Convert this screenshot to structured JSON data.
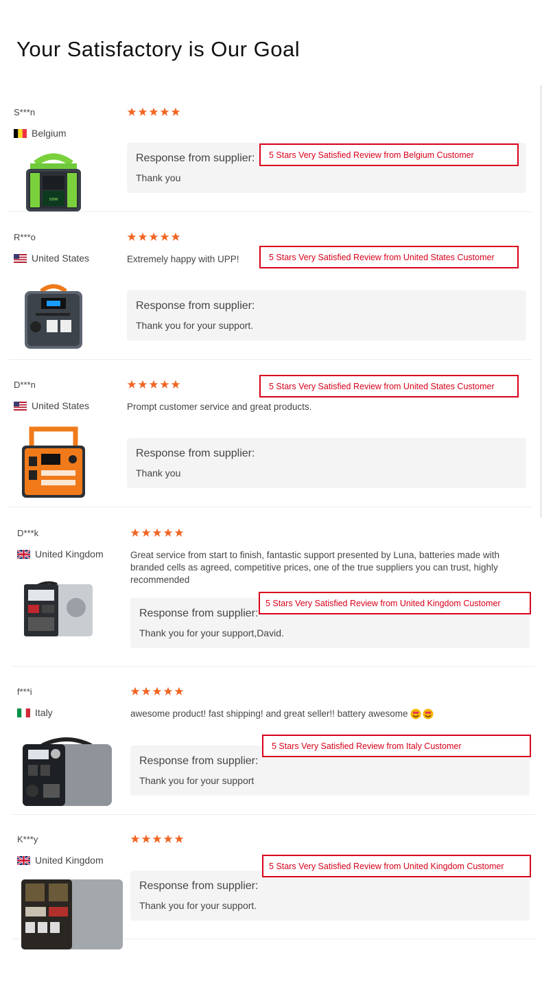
{
  "page": {
    "title": "Your Satisfactory is Our Goal"
  },
  "colors": {
    "star": "#f26522",
    "callout_border": "#d8001a",
    "response_bg": "#f4f4f4"
  },
  "reviews": [
    {
      "reviewer": "S***n",
      "country": "Belgium",
      "flag": "be-flag-icon",
      "rating": 5,
      "comment": "",
      "response_title": "Response from supplier:",
      "response_text": "Thank you",
      "callout": "5 Stars Very Satisfied Review from Belgium Customer"
    },
    {
      "reviewer": "R***o",
      "country": "United States",
      "flag": "us-flag-icon",
      "rating": 5,
      "comment": "Extremely happy with UPP!",
      "response_title": "Response from supplier:",
      "response_text": "Thank you for your support.",
      "callout": "5 Stars Very Satisfied Review from United States Customer"
    },
    {
      "reviewer": "D***n",
      "country": "United States",
      "flag": "us-flag-icon",
      "rating": 5,
      "comment": "Prompt customer service and great products.",
      "response_title": "Response from supplier:",
      "response_text": "Thank you",
      "callout": "5 Stars Very Satisfied Review from United States Customer"
    },
    {
      "reviewer": "D***k",
      "country": "United Kingdom",
      "flag": "uk-flag-icon",
      "rating": 5,
      "comment": "Great service from start to finish, fantastic support presented by Luna, batteries made with branded cells as agreed, competitive prices, one of the true suppliers you can trust, highly recommended",
      "response_title": "Response from supplier:",
      "response_text": "Thank you for your support,David.",
      "callout": "5 Stars Very Satisfied Review from United Kingdom Customer"
    },
    {
      "reviewer": "f***i",
      "country": "Italy",
      "flag": "it-flag-icon",
      "rating": 5,
      "comment": "awesome product! fast shipping! and great seller!! battery awesome",
      "response_title": "Response from supplier:",
      "response_text": "Thank you for your support",
      "callout": "5 Stars Very Satisfied Review from Italy Customer"
    },
    {
      "reviewer": "K***y",
      "country": "United Kingdom",
      "flag": "uk-flag-icon",
      "rating": 5,
      "comment": "",
      "response_title": "Response from supplier:",
      "response_text": "Thank you for your support.",
      "callout": "5 Stars Very Satisfied Review from United Kingdom Customer"
    }
  ]
}
